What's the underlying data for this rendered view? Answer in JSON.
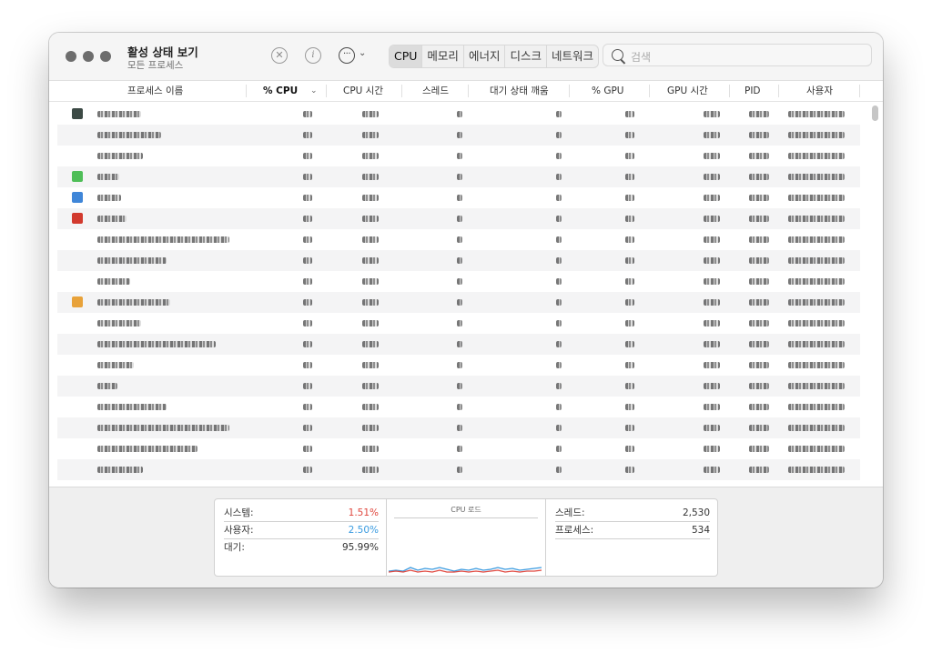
{
  "window": {
    "title": "활성 상태 보기",
    "subtitle": "모든 프로세스"
  },
  "toolbar": {
    "tabs": [
      {
        "label": "CPU",
        "active": true
      },
      {
        "label": "메모리",
        "active": false
      },
      {
        "label": "에너지",
        "active": false
      },
      {
        "label": "디스크",
        "active": false
      },
      {
        "label": "네트워크",
        "active": false
      }
    ],
    "search_placeholder": "검색"
  },
  "columns": [
    "프로세스 이름",
    "% CPU",
    "CPU 시간",
    "스레드",
    "대기 상태 깨움",
    "% GPU",
    "GPU 시간",
    "PID",
    "사용자"
  ],
  "sort_column": "% CPU",
  "process_rows": [
    {
      "icon_color": "#3c4a45"
    },
    {
      "icon_color": null
    },
    {
      "icon_color": null
    },
    {
      "icon_color": "#4fbe58"
    },
    {
      "icon_color": "#3f86d8"
    },
    {
      "icon_color": "#d23a2e"
    },
    {
      "icon_color": null
    },
    {
      "icon_color": null
    },
    {
      "icon_color": null
    },
    {
      "icon_color": "#e8a23a"
    },
    {
      "icon_color": null
    },
    {
      "icon_color": null
    },
    {
      "icon_color": null
    },
    {
      "icon_color": null
    },
    {
      "icon_color": null
    },
    {
      "icon_color": null
    },
    {
      "icon_color": null
    },
    {
      "icon_color": null
    }
  ],
  "summary": {
    "system_label": "시스템:",
    "system_value": "1.51%",
    "system_color": "#e0473e",
    "user_label": "사용자:",
    "user_value": "2.50%",
    "user_color": "#3a9be0",
    "idle_label": "대기:",
    "idle_value": "95.99%",
    "chart_title": "CPU 로드",
    "threads_label": "스레드:",
    "threads_value": "2,530",
    "processes_label": "프로세스:",
    "processes_value": "534"
  }
}
